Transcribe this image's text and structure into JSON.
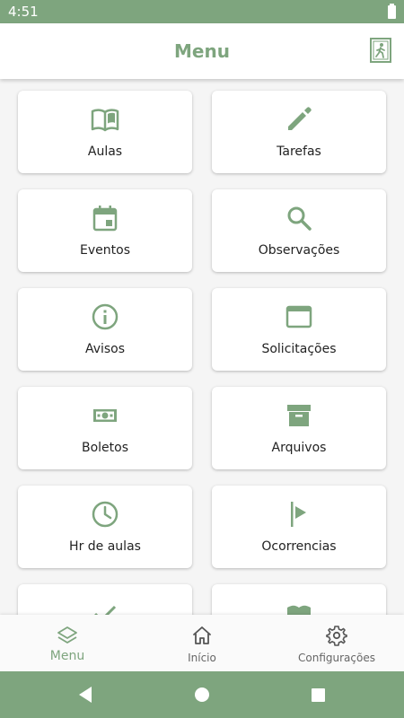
{
  "status_bar": {
    "time": "4:51"
  },
  "app_bar": {
    "title": "Menu"
  },
  "menu": [
    {
      "label": "Aulas",
      "icon": "book-open-icon"
    },
    {
      "label": "Tarefas",
      "icon": "pencil-icon"
    },
    {
      "label": "Eventos",
      "icon": "calendar-icon"
    },
    {
      "label": "Observações",
      "icon": "search-icon"
    },
    {
      "label": "Avisos",
      "icon": "info-icon"
    },
    {
      "label": "Solicitações",
      "icon": "window-icon"
    },
    {
      "label": "Boletos",
      "icon": "money-icon"
    },
    {
      "label": "Arquivos",
      "icon": "archive-icon"
    },
    {
      "label": "Hr de aulas",
      "icon": "clock-icon"
    },
    {
      "label": "Ocorrencias",
      "icon": "flag-icon"
    },
    {
      "label": "",
      "icon": "check-icon"
    },
    {
      "label": "",
      "icon": "book-icon"
    }
  ],
  "bottom_nav": {
    "menu": "Menu",
    "home": "Início",
    "settings": "Configurações"
  },
  "colors": {
    "accent": "#7ea57e",
    "background": "#f5f5f5",
    "card": "#ffffff",
    "text": "#222222"
  }
}
